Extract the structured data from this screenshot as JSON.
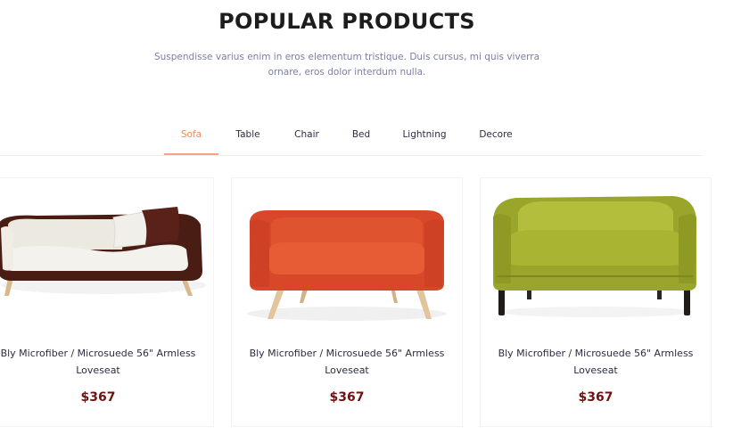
{
  "section": {
    "title": "POPULAR PRODUCTS",
    "subtitle": "Suspendisse varius enim in eros elementum tristique. Duis cursus, mi quis viverra ornare, eros dolor interdum nulla."
  },
  "tabs": [
    {
      "label": "Sofa",
      "active": true
    },
    {
      "label": "Table",
      "active": false
    },
    {
      "label": "Chair",
      "active": false
    },
    {
      "label": "Bed",
      "active": false
    },
    {
      "label": "Lightning",
      "active": false
    },
    {
      "label": "Decore",
      "active": false
    }
  ],
  "products": [
    {
      "name": "Bly Microfiber / Microsuede 56\" Armless Loveseat",
      "price": "$367",
      "image": "sofa-brown-white-image"
    },
    {
      "name": "Bly Microfiber / Microsuede 56\" Armless Loveseat",
      "price": "$367",
      "image": "sofa-orange-image"
    },
    {
      "name": "Bly Microfiber / Microsuede 56\" Armless Loveseat",
      "price": "$367",
      "image": "sofa-olive-green-image"
    }
  ],
  "colors": {
    "accent": "#f08a63",
    "price": "#6e1413",
    "text": "#2b2d42",
    "muted": "#7b7fa3"
  }
}
